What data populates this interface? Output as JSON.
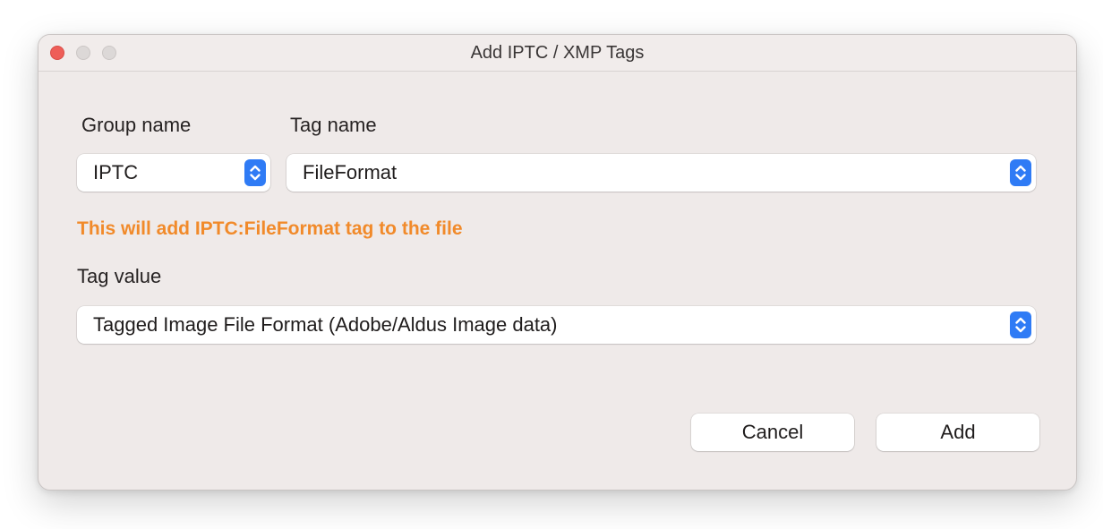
{
  "window": {
    "title": "Add IPTC / XMP Tags"
  },
  "labels": {
    "group_name": "Group name",
    "tag_name": "Tag name",
    "tag_value": "Tag value"
  },
  "fields": {
    "group_name_value": "IPTC",
    "tag_name_value": "FileFormat",
    "tag_value_value": "Tagged Image File Format (Adobe/Aldus Image data)"
  },
  "hint": {
    "text": "This will add IPTC:FileFormat tag to the file",
    "color": "#f18a2a"
  },
  "buttons": {
    "cancel": "Cancel",
    "add": "Add"
  },
  "icons": {
    "close": "close-traffic-light-icon",
    "minimize": "minimize-traffic-light-icon",
    "zoom": "zoom-traffic-light-icon",
    "stepper": "chevron-up-down-icon"
  },
  "colors": {
    "accent": "#2f7bf5",
    "close_red": "#ee5e58",
    "window_bg": "#efeae9"
  }
}
